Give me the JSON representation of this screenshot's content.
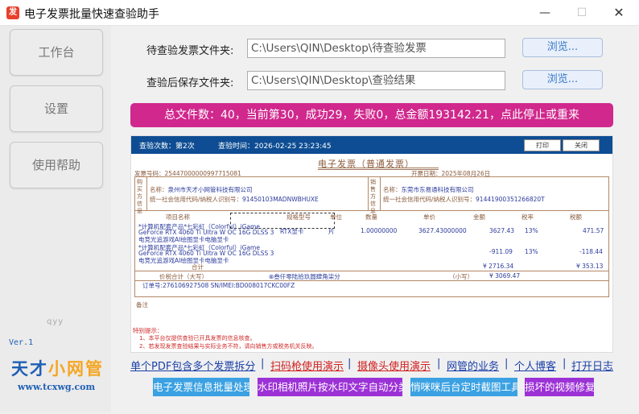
{
  "window": {
    "title": "电子发票批量快速查验助手",
    "app_icon": "发",
    "minimize": "—",
    "maximize": "☐",
    "close": "✕"
  },
  "sidebar": {
    "items": [
      {
        "label": "工作台"
      },
      {
        "label": "设置"
      },
      {
        "label": "使用帮助"
      }
    ],
    "watermark": "qyy",
    "version": "Ver.1",
    "logo": {
      "part1": "天才",
      "part2": "小网管",
      "url": "www.tcxwg.com"
    },
    "logo_colors": {
      "text": "#1f5fb5",
      "highlight": "#f5a623"
    }
  },
  "form": {
    "pending_label": "待查验发票文件夹:",
    "pending_value": "C:\\Users\\QIN\\Desktop\\待查验发票",
    "result_label": "查验后保存文件夹:",
    "result_value": "C:\\Users\\QIN\\Desktop\\查验结果",
    "browse_label": "浏览..."
  },
  "status": {
    "text": "总文件数：40，当前第30，成功29，失败0，总金额193142.21，点此停止或重来",
    "color": "#d0288d"
  },
  "preview": {
    "check_count": "查验次数：第2次",
    "check_time": "查验时间：2026-02-25 23:23:45",
    "print_label": "打印",
    "close_label": "关闭",
    "invoice_title": "电子发票（普通发票）",
    "invoice_no_label": "发票号码：",
    "invoice_no": "25447000000997715081",
    "issue_date_label": "开票日期：",
    "issue_date": "2025年08月26日",
    "buyer_tag": "购买方信息",
    "seller_tag": "销售方信息",
    "buyer_name_label": "名称：",
    "buyer_name": "泉州市天才小网管科技有限公司",
    "buyer_tax_label": "统一社会信用代码/纳税人识别号：",
    "buyer_tax": "91450103MADNWBHUXE",
    "seller_name_label": "名称：",
    "seller_name": "东莞市东易通科技有限公司",
    "seller_tax_label": "统一社会信用代码/纳税人识别号：",
    "seller_tax": "91441900351266820T",
    "headers": {
      "item": "项目名称",
      "spec": "规格型号",
      "unit": "单位",
      "qty": "数量",
      "price": "单价",
      "amount": "金额",
      "rate": "税率",
      "tax": "税额"
    },
    "items": [
      {
        "name1": "*计算机配套产品*七彩虹（Colorful）iGame",
        "name2": "GeForce RTX 4060 Ti Ultra W OC 16G DLSS 3",
        "name3": "电竞光追游戏AI绘图显卡电脑显卡",
        "spec": "RTX显卡",
        "unit": "片",
        "qty": "1.00000000",
        "price": "3627.43000000",
        "amount": "3627.43",
        "rate": "13%",
        "tax": "471.57"
      },
      {
        "name1": "*计算机配套产品*七彩虹（Colorful）iGame",
        "name2": "GeForce RTX 4060 Ti Ultra W OC 16G DLSS 3",
        "name3": "电竞光追游戏AI绘图显卡电脑显卡",
        "amount": "-911.09",
        "rate": "13%",
        "tax": "-118.44"
      }
    ],
    "total_label": "合计",
    "total_amount": "¥ 2716.34",
    "total_tax": "¥ 353.13",
    "grand_label": "价税合计（大写）",
    "grand_words": "⊗叁仟零陆拾玖圆肆角柒分",
    "grand_small_label": "（小写）",
    "grand_small": "¥ 3069.47",
    "remarks_label": "备注",
    "remarks_text": "订单号:276106927508 SN/IMEI:BD008017CKC00FZ",
    "note_head": "特别提示：",
    "note1": "1、本平台仅提供查验已开具发票的信息核查。",
    "note2": "2、若发现发票查验结果与实际业务不符，请向销售方或税务机关反映。"
  },
  "links": [
    {
      "label": "单个PDF包含多个发票拆分",
      "color": "#1a3fa8"
    },
    {
      "label": "扫码枪使用演示",
      "color": "#d21f1f"
    },
    {
      "label": "摄像头使用演示",
      "color": "#d21f1f"
    },
    {
      "label": "网管的业务",
      "color": "#1a3fa8"
    },
    {
      "label": "个人博客",
      "color": "#1a3fa8"
    },
    {
      "label": "打开日志",
      "color": "#1a3fa8"
    }
  ],
  "link_separator": "|",
  "bottom_buttons": [
    {
      "label": "电子发票信息批量处理",
      "color": "#3ba1e2"
    },
    {
      "label": "水印相机照片按水印文字自动分类",
      "color": "#9c32d6"
    },
    {
      "label": "悄咪咪后台定时截图工具",
      "color": "#3ba1e2"
    },
    {
      "label": "损坏的视频修复",
      "color": "#9c32d6"
    }
  ]
}
